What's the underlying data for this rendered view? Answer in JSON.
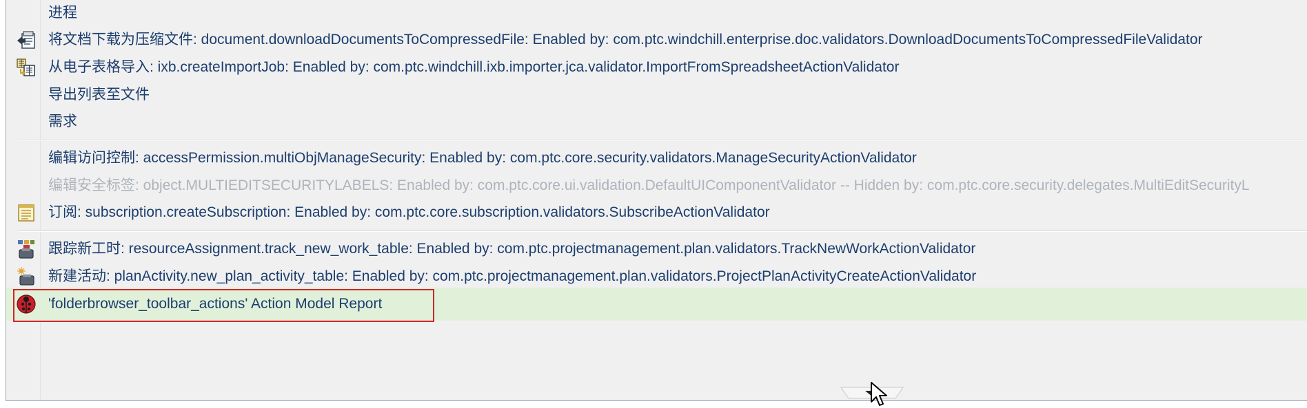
{
  "menu": {
    "items": [
      {
        "label": "进程",
        "icon": null,
        "enabled": true
      },
      {
        "label": "将文档下载为压缩文件: document.downloadDocumentsToCompressedFile: Enabled by: com.ptc.windchill.enterprise.doc.validators.DownloadDocumentsToCompressedFileValidator",
        "icon": "download-compressed-icon",
        "enabled": true
      },
      {
        "label": "从电子表格导入: ixb.createImportJob: Enabled by: com.ptc.windchill.ixb.importer.jca.validator.ImportFromSpreadsheetActionValidator",
        "icon": "import-spreadsheet-icon",
        "enabled": true
      },
      {
        "label": "导出列表至文件",
        "icon": null,
        "enabled": true
      },
      {
        "label": "需求",
        "icon": null,
        "enabled": true
      },
      {
        "label": "编辑访问控制: accessPermission.multiObjManageSecurity: Enabled by: com.ptc.core.security.validators.ManageSecurityActionValidator",
        "icon": null,
        "enabled": true
      },
      {
        "label": "编辑安全标签: object.MULTIEDITSECURITYLABELS: Enabled by: com.ptc.core.ui.validation.DefaultUIComponentValidator -- Hidden by: com.ptc.core.security.delegates.MultiEditSecurityL",
        "icon": null,
        "enabled": false
      },
      {
        "label": "订阅: subscription.createSubscription: Enabled by: com.ptc.core.subscription.validators.SubscribeActionValidator",
        "icon": "subscription-icon",
        "enabled": true
      },
      {
        "label": "跟踪新工时: resourceAssignment.track_new_work_table: Enabled by: com.ptc.projectmanagement.plan.validators.TrackNewWorkActionValidator",
        "icon": "track-work-icon",
        "enabled": true
      },
      {
        "label": "新建活动: planActivity.new_plan_activity_table: Enabled by: com.ptc.projectmanagement.plan.validators.ProjectPlanActivityCreateActionValidator",
        "icon": "new-activity-icon",
        "enabled": true
      },
      {
        "label": "'folderbrowser_toolbar_actions' Action Model Report",
        "icon": "ladybug-icon",
        "enabled": true,
        "highlighted": true
      }
    ]
  },
  "colors": {
    "text": "#1c3e6e",
    "disabled_text": "#aeb4bc",
    "menu_bg": "#f0f0f0",
    "highlight_bg": "#e1f0d9",
    "highlight_border": "#d6202b"
  },
  "scroll_icon": "scroll-down-icon",
  "cursor_icon": "mouse-cursor-icon"
}
